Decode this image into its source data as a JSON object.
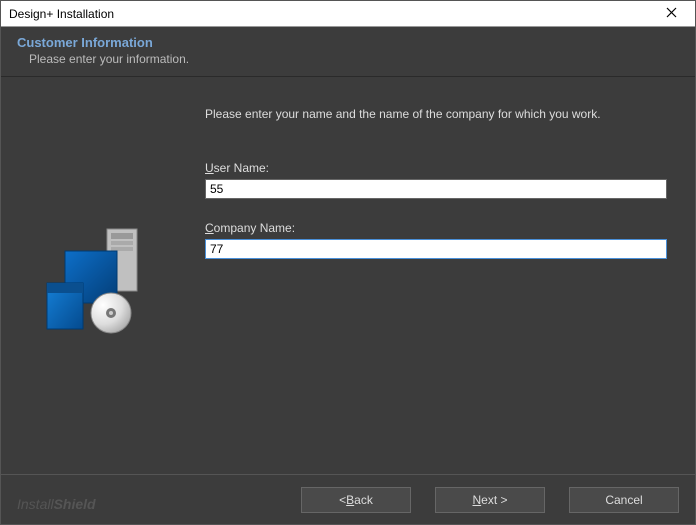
{
  "window": {
    "title": "Design+ Installation"
  },
  "header": {
    "title": "Customer Information",
    "subtitle": "Please enter your information."
  },
  "content": {
    "instruction": "Please enter your name and the name of the company for which you work.",
    "userNameLabel_pre": "",
    "userNameLabel_u": "U",
    "userNameLabel_post": "ser Name:",
    "userNameValue": "55",
    "companyNameLabel_pre": "",
    "companyNameLabel_u": "C",
    "companyNameLabel_post": "ompany Name:",
    "companyNameValue": "77"
  },
  "footer": {
    "brand_a": "Install",
    "brand_b": "Shield",
    "back_pre": "< ",
    "back_u": "B",
    "back_post": "ack",
    "next_pre": "",
    "next_u": "N",
    "next_post": "ext >",
    "cancel": "Cancel"
  }
}
